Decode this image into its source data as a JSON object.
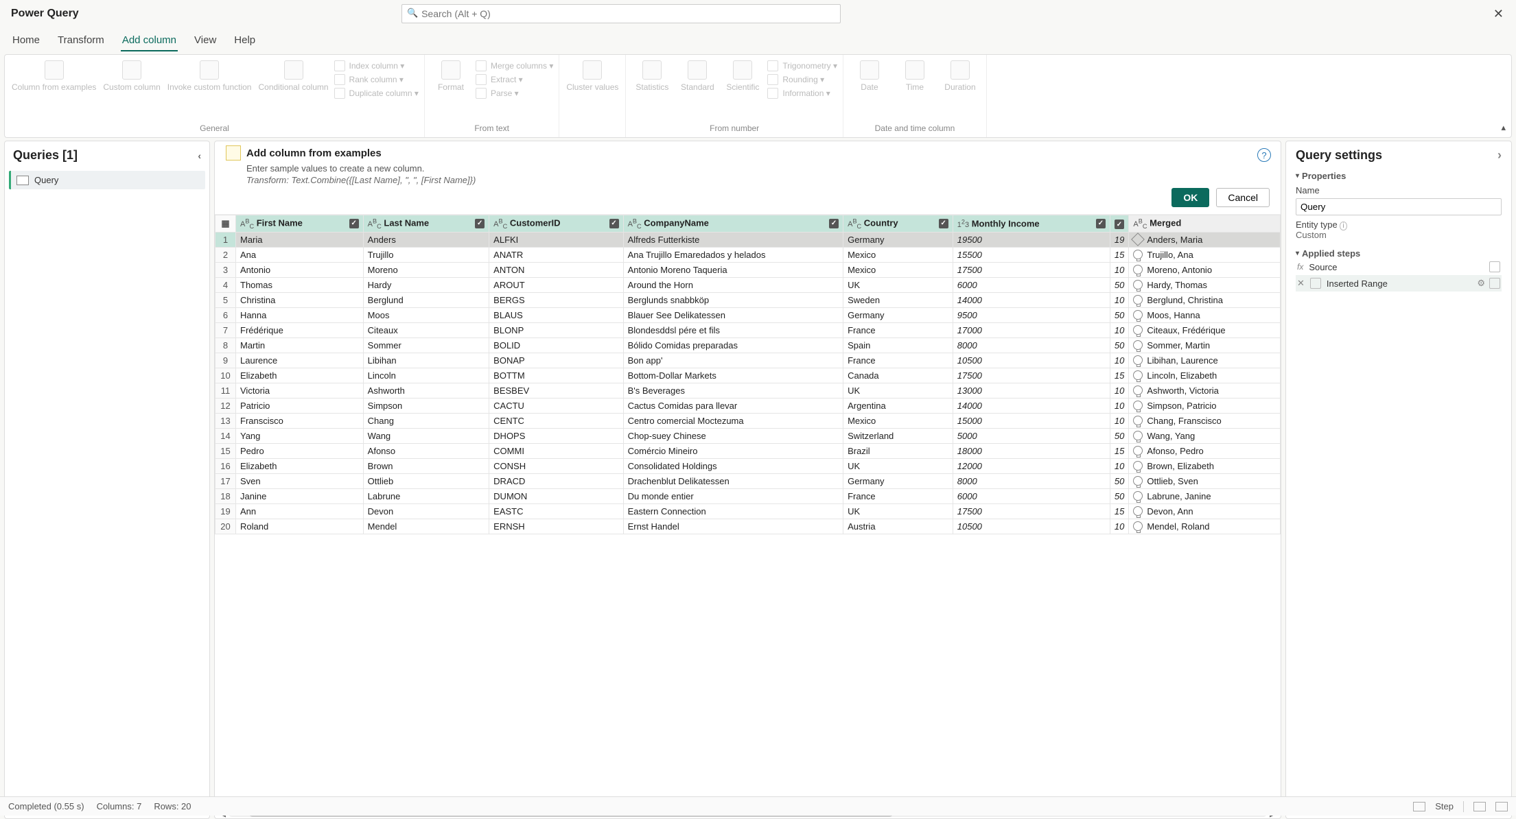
{
  "app_title": "Power Query",
  "search_placeholder": "Search (Alt + Q)",
  "tabs": [
    "Home",
    "Transform",
    "Add column",
    "View",
    "Help"
  ],
  "active_tab_index": 2,
  "ribbon": {
    "groups": [
      {
        "label": "General",
        "items_big": [
          "Column from examples",
          "Custom column",
          "Invoke custom function",
          "Conditional column"
        ],
        "items_side": [
          "Index column",
          "Rank column",
          "Duplicate column"
        ]
      },
      {
        "label": "From text",
        "items_big": [
          "Format"
        ],
        "items_side": [
          "Merge columns",
          "Extract",
          "Parse"
        ]
      },
      {
        "label": "",
        "items_big": [
          "Cluster values"
        ],
        "items_side": []
      },
      {
        "label": "From number",
        "items_big": [
          "Statistics",
          "Standard",
          "Scientific"
        ],
        "items_side": [
          "Trigonometry",
          "Rounding",
          "Information"
        ]
      },
      {
        "label": "Date and time column",
        "items_big": [
          "Date",
          "Time",
          "Duration"
        ],
        "items_side": []
      }
    ]
  },
  "queries_panel": {
    "title": "Queries [1]",
    "items": [
      "Query"
    ]
  },
  "prompt": {
    "title": "Add column from examples",
    "subtitle": "Enter sample values to create a new column.",
    "transform": "Transform: Text.Combine({[Last Name], \", \", [First Name]})",
    "ok": "OK",
    "cancel": "Cancel"
  },
  "columns": [
    {
      "name": "First Name",
      "dtype": "ABC"
    },
    {
      "name": "Last Name",
      "dtype": "ABC"
    },
    {
      "name": "CustomerID",
      "dtype": "ABC"
    },
    {
      "name": "CompanyName",
      "dtype": "ABC"
    },
    {
      "name": "Country",
      "dtype": "ABC"
    },
    {
      "name": "Monthly Income",
      "dtype": "123"
    }
  ],
  "merged_header": "Merged",
  "income2_vals": [
    "19",
    "15",
    "10",
    "50",
    "10",
    "50",
    "10",
    "50",
    "10",
    "15",
    "10",
    "10",
    "10",
    "50",
    "15",
    "10",
    "50",
    "50",
    "15",
    "10"
  ],
  "rows": [
    {
      "first": "Maria",
      "last": "Anders",
      "cid": "ALFKI",
      "company": "Alfreds Futterkiste",
      "country": "Germany",
      "income": "19500",
      "merged": "Anders, Maria",
      "entered": true
    },
    {
      "first": "Ana",
      "last": "Trujillo",
      "cid": "ANATR",
      "company": "Ana Trujillo Emaredados y helados",
      "country": "Mexico",
      "income": "15500",
      "merged": "Trujillo, Ana"
    },
    {
      "first": "Antonio",
      "last": "Moreno",
      "cid": "ANTON",
      "company": "Antonio Moreno Taqueria",
      "country": "Mexico",
      "income": "17500",
      "merged": "Moreno, Antonio"
    },
    {
      "first": "Thomas",
      "last": "Hardy",
      "cid": "AROUT",
      "company": "Around the Horn",
      "country": "UK",
      "income": "6000",
      "merged": "Hardy, Thomas"
    },
    {
      "first": "Christina",
      "last": "Berglund",
      "cid": "BERGS",
      "company": "Berglunds snabbköp",
      "country": "Sweden",
      "income": "14000",
      "merged": "Berglund, Christina"
    },
    {
      "first": "Hanna",
      "last": "Moos",
      "cid": "BLAUS",
      "company": "Blauer See Delikatessen",
      "country": "Germany",
      "income": "9500",
      "merged": "Moos, Hanna"
    },
    {
      "first": "Frédérique",
      "last": "Citeaux",
      "cid": "BLONP",
      "company": "Blondesddsl pére et fils",
      "country": "France",
      "income": "17000",
      "merged": "Citeaux, Frédérique"
    },
    {
      "first": "Martin",
      "last": "Sommer",
      "cid": "BOLID",
      "company": "Bólido Comidas preparadas",
      "country": "Spain",
      "income": "8000",
      "merged": "Sommer, Martin"
    },
    {
      "first": "Laurence",
      "last": "Libihan",
      "cid": "BONAP",
      "company": "Bon app'",
      "country": "France",
      "income": "10500",
      "merged": "Libihan, Laurence"
    },
    {
      "first": "Elizabeth",
      "last": "Lincoln",
      "cid": "BOTTM",
      "company": "Bottom-Dollar Markets",
      "country": "Canada",
      "income": "17500",
      "merged": "Lincoln, Elizabeth"
    },
    {
      "first": "Victoria",
      "last": "Ashworth",
      "cid": "BESBEV",
      "company": "B's Beverages",
      "country": "UK",
      "income": "13000",
      "merged": "Ashworth, Victoria"
    },
    {
      "first": "Patricio",
      "last": "Simpson",
      "cid": "CACTU",
      "company": "Cactus Comidas para llevar",
      "country": "Argentina",
      "income": "14000",
      "merged": "Simpson, Patricio"
    },
    {
      "first": "Franscisco",
      "last": "Chang",
      "cid": "CENTC",
      "company": "Centro comercial Moctezuma",
      "country": "Mexico",
      "income": "15000",
      "merged": "Chang, Franscisco"
    },
    {
      "first": "Yang",
      "last": "Wang",
      "cid": "DHOPS",
      "company": "Chop-suey Chinese",
      "country": "Switzerland",
      "income": "5000",
      "merged": "Wang, Yang"
    },
    {
      "first": "Pedro",
      "last": "Afonso",
      "cid": "COMMI",
      "company": "Comércio Mineiro",
      "country": "Brazil",
      "income": "18000",
      "merged": "Afonso, Pedro"
    },
    {
      "first": "Elizabeth",
      "last": "Brown",
      "cid": "CONSH",
      "company": "Consolidated Holdings",
      "country": "UK",
      "income": "12000",
      "merged": "Brown, Elizabeth"
    },
    {
      "first": "Sven",
      "last": "Ottlieb",
      "cid": "DRACD",
      "company": "Drachenblut Delikatessen",
      "country": "Germany",
      "income": "8000",
      "merged": "Ottlieb, Sven"
    },
    {
      "first": "Janine",
      "last": "Labrune",
      "cid": "DUMON",
      "company": "Du monde entier",
      "country": "France",
      "income": "6000",
      "merged": "Labrune, Janine"
    },
    {
      "first": "Ann",
      "last": "Devon",
      "cid": "EASTC",
      "company": "Eastern Connection",
      "country": "UK",
      "income": "17500",
      "merged": "Devon, Ann"
    },
    {
      "first": "Roland",
      "last": "Mendel",
      "cid": "ERNSH",
      "company": "Ernst Handel",
      "country": "Austria",
      "income": "10500",
      "merged": "Mendel, Roland"
    }
  ],
  "settings": {
    "title": "Query settings",
    "properties": "Properties",
    "name_label": "Name",
    "name_value": "Query",
    "entity_label": "Entity type",
    "entity_value": "Custom",
    "applied": "Applied steps",
    "step1": "Source",
    "step2": "Inserted Range"
  },
  "status": {
    "completed": "Completed (0.55 s)",
    "cols": "Columns: 7",
    "rows": "Rows: 20",
    "step": "Step"
  }
}
